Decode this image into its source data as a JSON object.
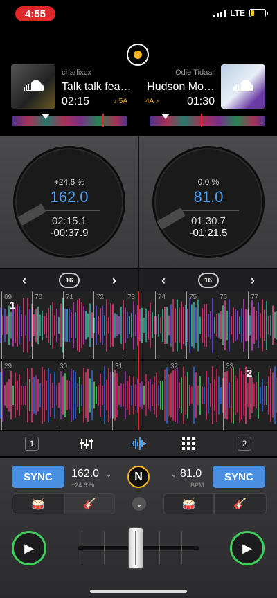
{
  "status": {
    "time": "4:55",
    "network": "LTE"
  },
  "decks": [
    {
      "artist": "charlixcx",
      "title": "Talk talk fea…",
      "time": "02:15",
      "key": "♪ 5A",
      "pitch": "+24.6 %",
      "bpm": "162.0",
      "elapsed": "02:15.1",
      "remaining": "-00:37.9",
      "loop": "16",
      "id": "1"
    },
    {
      "artist": "Odie Tidaar",
      "title": "Hudson Mo…",
      "time": "01:30",
      "key": "4A ♪",
      "pitch": "0.0 %",
      "bpm": "81.0",
      "elapsed": "01:30.7",
      "remaining": "-01:21.5",
      "loop": "16",
      "id": "2"
    }
  ],
  "beats_top": [
    "69",
    "70",
    "71",
    "72",
    "73",
    "74",
    "75",
    "76",
    "77"
  ],
  "beats_bottom": [
    "29",
    "30",
    "31",
    "32",
    "33"
  ],
  "toolbar": {
    "deck1": "1",
    "deck2": "2"
  },
  "mixer": {
    "sync_label": "SYNC",
    "left_bpm": "162.0",
    "left_pitch": "+24.6 %",
    "right_bpm": "81.0",
    "right_unit": "BPM",
    "center_logo": "N"
  },
  "colors": {
    "accent_blue": "#4ea1f0",
    "sync_blue": "#4a90e2",
    "play_green": "#3ccf5a",
    "record_yellow": "#f5b61c",
    "status_red": "#e0282c"
  }
}
